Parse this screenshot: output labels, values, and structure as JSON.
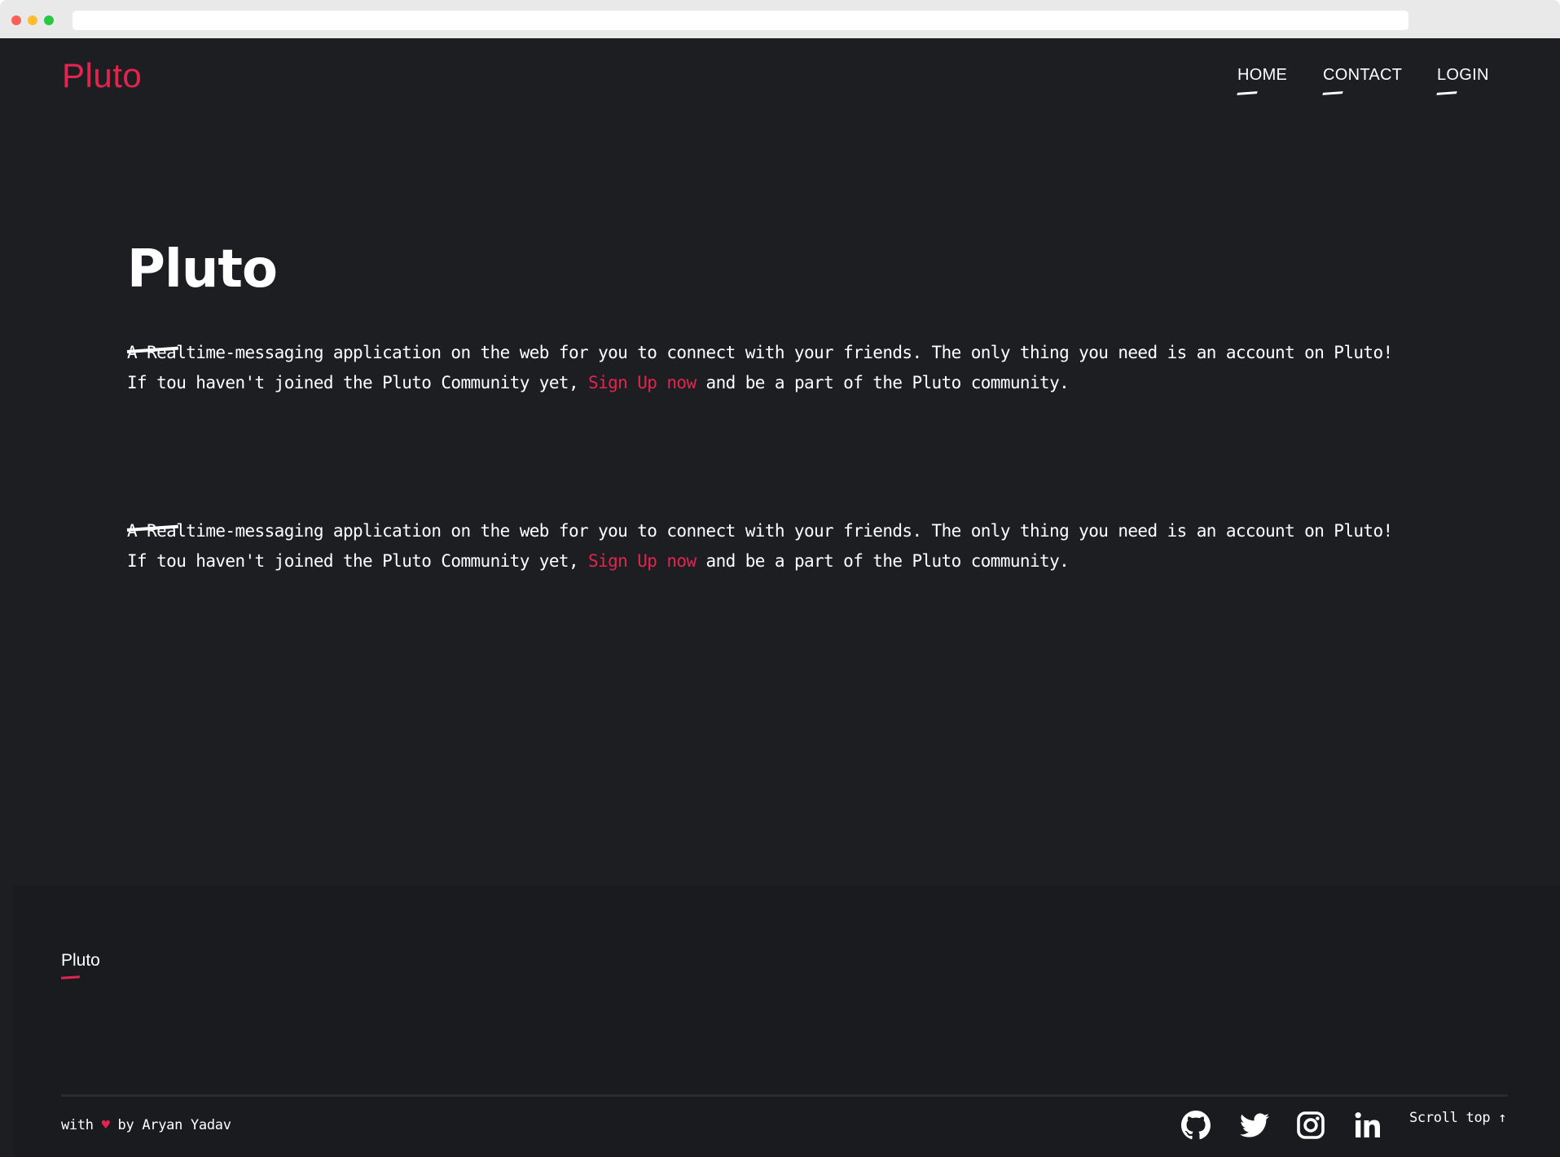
{
  "brand": {
    "name": "Pluto",
    "accent_color": "#e2254f",
    "background": "#1d1e22"
  },
  "nav": {
    "items": [
      {
        "label": "HOME"
      },
      {
        "label": "CONTACT"
      },
      {
        "label": "LOGIN"
      }
    ]
  },
  "hero": {
    "title": "Pluto",
    "sections": [
      {
        "line1": "A Realtime-messaging application on the web for you to connect with your friends. The only thing you need is an account on Pluto!",
        "line2_before": "If tou haven't joined the Pluto Community yet, ",
        "link": "Sign Up now",
        "line2_after": " and be a part of the Pluto community."
      },
      {
        "line1": "A Realtime-messaging application on the web for you to connect with your friends. The only thing you need is an account on Pluto!",
        "line2_before": "If tou haven't joined the Pluto Community yet, ",
        "link": "Sign Up now",
        "line2_after": " and be a part of the Pluto community."
      }
    ]
  },
  "footer": {
    "logo": "Pluto",
    "credit_prefix": "with ",
    "heart": "♥",
    "credit_suffix": " by Aryan Yadav",
    "social_icons": [
      "github-icon",
      "twitter-icon",
      "instagram-icon",
      "linkedin-icon"
    ],
    "scroll_top": "Scroll top ↑"
  }
}
